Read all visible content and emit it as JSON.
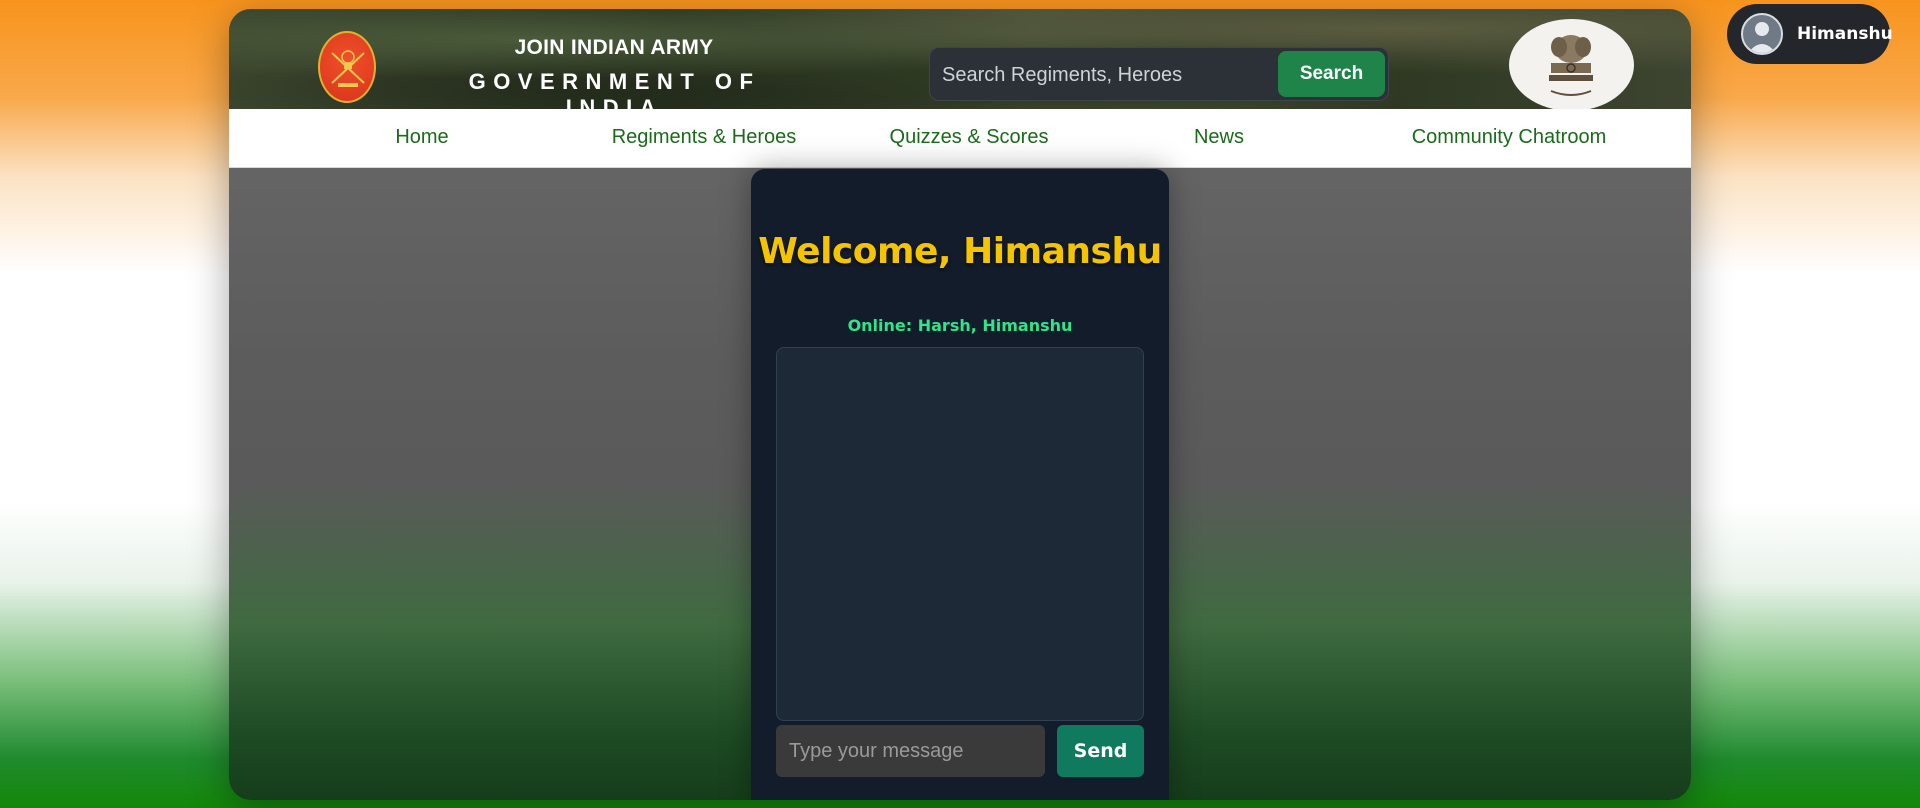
{
  "header": {
    "title": "JOIN INDIAN ARMY",
    "subtitle": "GOVERNMENT OF INDIA",
    "army_emblem_icon": "indian-army-crest-icon",
    "national_emblem_icon": "ashoka-lion-capital-icon"
  },
  "search": {
    "placeholder": "Search Regiments, Heroes",
    "value": "",
    "button_label": "Search"
  },
  "nav": {
    "items": [
      {
        "label": "Home"
      },
      {
        "label": "Regiments & Heroes"
      },
      {
        "label": "Quizzes & Scores"
      },
      {
        "label": "News"
      },
      {
        "label": "Community Chatroom"
      }
    ]
  },
  "chat": {
    "welcome": "Welcome, Himanshu",
    "online": "Online: Harsh, Himanshu",
    "messages": [],
    "input_placeholder": "Type your message",
    "input_value": "",
    "send_label": "Send"
  },
  "user": {
    "name": "Himanshu",
    "avatar_icon": "user-avatar-icon"
  },
  "colors": {
    "accent_green": "#1e8449",
    "welcome_yellow": "#f5c400",
    "online_green": "#2ee58a",
    "nav_text": "#1a6b1a",
    "panel_bg": "#131c2b"
  }
}
